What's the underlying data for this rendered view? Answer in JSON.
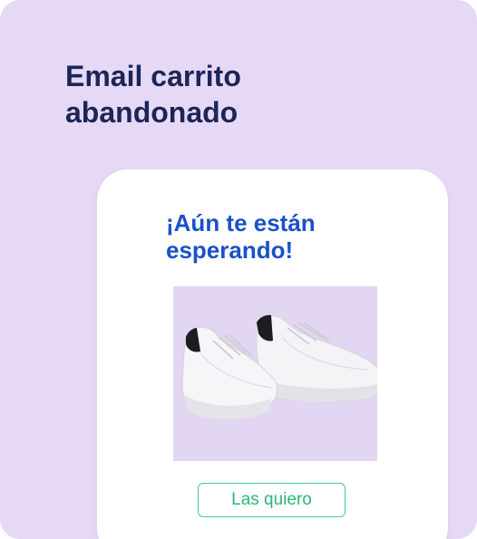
{
  "header": {
    "title": "Email carrito abandonado"
  },
  "email": {
    "title": "¡Aún te están esperando!",
    "product_image": "white-sneakers-image",
    "cta_label": "Las quiero"
  },
  "colors": {
    "background": "#e6d9f5",
    "heading": "#1c2557",
    "email_title": "#1b51c7",
    "cta_border": "#3fcf8e",
    "cta_text": "#2fb477",
    "image_bg": "#e3d6f2"
  }
}
